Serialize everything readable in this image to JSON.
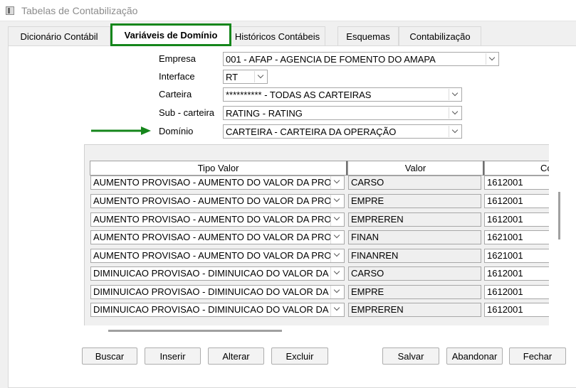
{
  "window": {
    "title": "Tabelas de Contabilização"
  },
  "tabs": [
    {
      "label": "Dicionário Contábil"
    },
    {
      "label": "Variáveis de Domínio"
    },
    {
      "label": "Históricos Contábeis"
    },
    {
      "label": "Esquemas"
    },
    {
      "label": "Contabilização"
    }
  ],
  "form": {
    "empresa": {
      "label": "Empresa",
      "value": "001 - AFAP - AGENCIA DE FOMENTO DO AMAPA"
    },
    "interface": {
      "label": "Interface",
      "value": "RT"
    },
    "carteira": {
      "label": "Carteira",
      "value": "********** - TODAS AS CARTEIRAS"
    },
    "subcarteira": {
      "label": "Sub - carteira",
      "value": "RATING - RATING"
    },
    "dominio": {
      "label": "Domínio",
      "value": "CARTEIRA - CARTEIRA DA OPERAÇÃO"
    }
  },
  "grid": {
    "headers": [
      "Tipo Valor",
      "Valor",
      "Co"
    ],
    "rows": [
      [
        "AUMENTO PROVISAO - AUMENTO DO VALOR DA PROVISAO",
        "CARSO",
        "1612001"
      ],
      [
        "AUMENTO PROVISAO - AUMENTO DO VALOR DA PROVISAO",
        "EMPRE",
        "1612001"
      ],
      [
        "AUMENTO PROVISAO - AUMENTO DO VALOR DA PROVISAO",
        "EMPREREN",
        "1612001"
      ],
      [
        "AUMENTO PROVISAO - AUMENTO DO VALOR DA PROVISAO",
        "FINAN",
        "1621001"
      ],
      [
        "AUMENTO PROVISAO - AUMENTO DO VALOR DA PROVISAO",
        "FINANREN",
        "1621001"
      ],
      [
        "DIMINUICAO PROVISAO - DIMINUICAO DO VALOR DA PROVISAO",
        "CARSO",
        "1612001"
      ],
      [
        "DIMINUICAO PROVISAO - DIMINUICAO DO VALOR DA PROVISAO",
        "EMPRE",
        "1612001"
      ],
      [
        "DIMINUICAO PROVISAO - DIMINUICAO DO VALOR DA PROVISAO",
        "EMPREREN",
        "1612001"
      ]
    ]
  },
  "buttons": {
    "buscar": "Buscar",
    "inserir": "Inserir",
    "alterar": "Alterar",
    "excluir": "Excluir",
    "salvar": "Salvar",
    "abandonar": "Abandonar",
    "fechar": "Fechar"
  },
  "colors": {
    "highlight": "#15861b",
    "arrow": "#15861b"
  }
}
